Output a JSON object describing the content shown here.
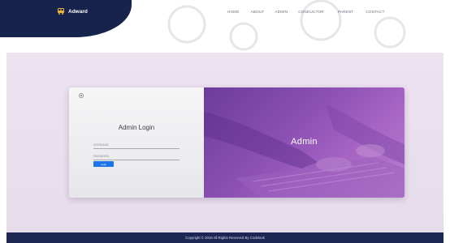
{
  "brand": {
    "name": "Adward"
  },
  "nav": {
    "items": [
      {
        "label": "HOME"
      },
      {
        "label": "ABOUT"
      },
      {
        "label": "ADMIN"
      },
      {
        "label": "CONDUCTOR"
      },
      {
        "label": "PARENT"
      },
      {
        "label": "CONTACT"
      }
    ]
  },
  "login": {
    "title": "Admin Login",
    "username_placeholder": "USERNAME",
    "password_placeholder": "PASSWORD",
    "button_label": "Login"
  },
  "hero": {
    "title": "Admin"
  },
  "footer": {
    "text": "Copyright © 2019 All Rights Reserved By Codelook"
  },
  "colors": {
    "header_dark": "#16234d",
    "accent_button": "#1c74e9",
    "hero_purple": "#8a4fb3",
    "footer": "#1c2753"
  },
  "icons": {
    "logo": "bus-icon",
    "corner": "settings-icon"
  }
}
